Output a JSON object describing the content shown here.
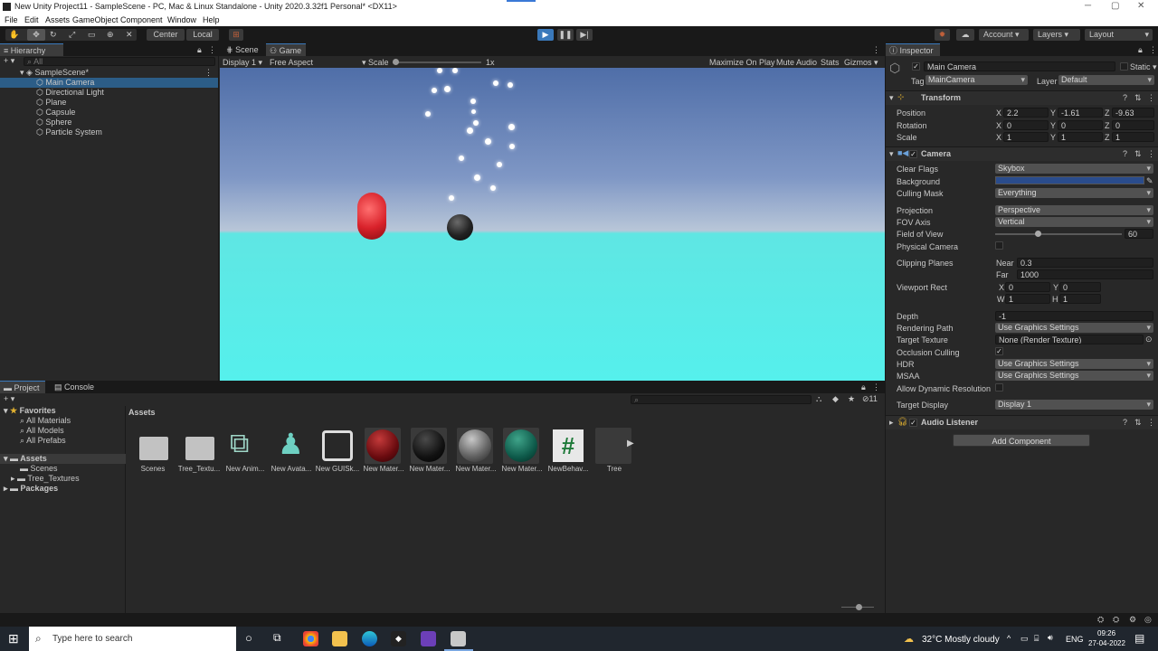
{
  "window": {
    "title": "New Unity Project11 - SampleScene - PC, Mac & Linux Standalone - Unity 2020.3.32f1 Personal* <DX11>"
  },
  "menu": [
    "File",
    "Edit",
    "Assets",
    "GameObject",
    "Component",
    "Window",
    "Help"
  ],
  "toolbar": {
    "pivot": "Center",
    "space": "Local",
    "account": "Account",
    "layers": "Layers",
    "layout": "Layout"
  },
  "hierarchy": {
    "tab": "Hierarchy",
    "search_placeholder": "All",
    "scene": "SampleScene*",
    "items": [
      "Main Camera",
      "Directional Light",
      "Plane",
      "Capsule",
      "Sphere",
      "Particle System"
    ]
  },
  "game": {
    "tab_scene": "Scene",
    "tab_game": "Game",
    "display": "Display 1",
    "aspect": "Free Aspect",
    "scale_label": "Scale",
    "scale_value": "1x",
    "maximize": "Maximize On Play",
    "mute": "Mute Audio",
    "stats": "Stats",
    "gizmos": "Gizmos"
  },
  "inspector": {
    "tab": "Inspector",
    "object_name": "Main Camera",
    "static": "Static",
    "tag_label": "Tag",
    "tag": "MainCamera",
    "layer_label": "Layer",
    "layer": "Default",
    "transform": {
      "title": "Transform",
      "position_label": "Position",
      "rotation_label": "Rotation",
      "scale_label": "Scale",
      "position": {
        "x": "2.2",
        "y": "-1.61",
        "z": "-9.63"
      },
      "rotation": {
        "x": "0",
        "y": "0",
        "z": "0"
      },
      "scale": {
        "x": "1",
        "y": "1",
        "z": "1"
      }
    },
    "camera": {
      "title": "Camera",
      "clear_flags_label": "Clear Flags",
      "clear_flags": "Skybox",
      "background_label": "Background",
      "background_color": "#2a4c8c",
      "culling_mask_label": "Culling Mask",
      "culling_mask": "Everything",
      "projection_label": "Projection",
      "projection": "Perspective",
      "fov_axis_label": "FOV Axis",
      "fov_axis": "Vertical",
      "fov_label": "Field of View",
      "fov": "60",
      "physical_label": "Physical Camera",
      "clipping_label": "Clipping Planes",
      "near_label": "Near",
      "near": "0.3",
      "far_label": "Far",
      "far": "1000",
      "viewport_label": "Viewport Rect",
      "vx": "0",
      "vy": "0",
      "vw": "1",
      "vh": "1",
      "depth_label": "Depth",
      "depth": "-1",
      "rendering_path_label": "Rendering Path",
      "rendering_path": "Use Graphics Settings",
      "target_texture_label": "Target Texture",
      "target_texture": "None (Render Texture)",
      "occlusion_label": "Occlusion Culling",
      "hdr_label": "HDR",
      "hdr": "Use Graphics Settings",
      "msaa_label": "MSAA",
      "msaa": "Use Graphics Settings",
      "dynres_label": "Allow Dynamic Resolution",
      "target_display_label": "Target Display",
      "target_display": "Display 1"
    },
    "audio_listener": "Audio Listener",
    "add_component": "Add Component"
  },
  "project": {
    "tab_project": "Project",
    "tab_console": "Console",
    "hidden_count": "11",
    "breadcrumb": "Assets",
    "favorites": "Favorites",
    "fav_items": [
      "All Materials",
      "All Models",
      "All Prefabs"
    ],
    "assets_root": "Assets",
    "asset_folders": [
      "Scenes",
      "Tree_Textures"
    ],
    "packages": "Packages",
    "assets": [
      "Scenes",
      "Tree_Textu...",
      "New Anim...",
      "New Avata...",
      "New GUISk...",
      "New Mater...",
      "New Mater...",
      "New Mater...",
      "New Mater...",
      "NewBehav...",
      "Tree"
    ]
  },
  "taskbar": {
    "search": "Type here to search",
    "weather": "32°C  Mostly cloudy",
    "lang": "ENG",
    "time": "09:26",
    "date": "27-04-2022"
  }
}
